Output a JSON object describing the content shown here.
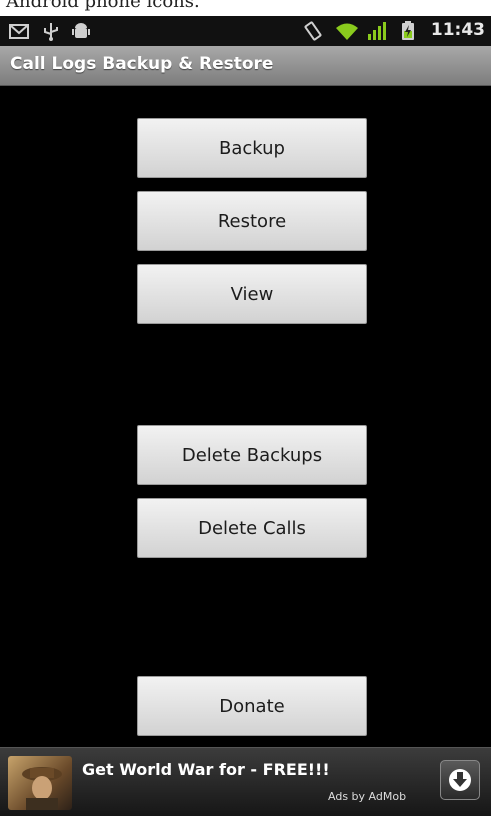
{
  "caption": {
    "text": "Android phone icons."
  },
  "status_bar": {
    "time": "11:43",
    "icons": [
      "gmail-icon",
      "usb-icon",
      "android-debug-icon",
      "vibrate-icon",
      "wifi-icon",
      "signal-icon",
      "battery-charging-icon"
    ]
  },
  "app": {
    "title": "Call Logs Backup & Restore"
  },
  "buttons": {
    "backup": "Backup",
    "restore": "Restore",
    "view": "View",
    "delete_backups": "Delete Backups",
    "delete_calls": "Delete Calls",
    "donate": "Donate"
  },
  "ad": {
    "title": "Get World War for - FREE!!!",
    "by": "Ads by AdMob",
    "icon": "download-icon"
  },
  "colors": {
    "background": "#000000",
    "title_bar": "#8e8e8e",
    "button": "#e2e2e2",
    "accent_green": "#8acb1d"
  }
}
